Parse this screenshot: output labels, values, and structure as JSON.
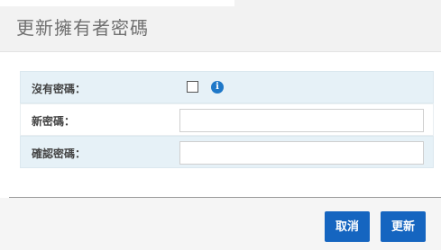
{
  "dialog": {
    "title": "更新擁有者密碼"
  },
  "form": {
    "no_password_label": "沒有密碼：",
    "no_password_checked": false,
    "new_password_label": "新密碼：",
    "new_password_value": "",
    "confirm_password_label": "確認密碼：",
    "confirm_password_value": ""
  },
  "footer": {
    "cancel_label": "取消",
    "update_label": "更新"
  },
  "icons": {
    "info": "info-icon"
  },
  "colors": {
    "accent": "#1565c0",
    "row_highlight": "#e6f1f7",
    "info_icon": "#1f78c8"
  }
}
